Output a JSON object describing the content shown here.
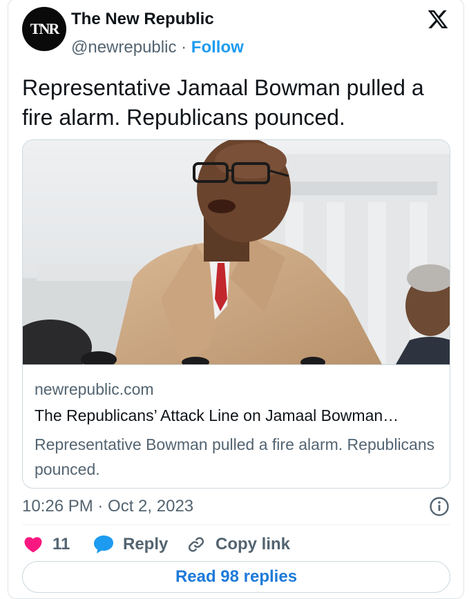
{
  "account": {
    "name": "The New Republic",
    "handle": "@newrepublic",
    "separator": "·",
    "follow_label": "Follow",
    "avatar_text": "TNR"
  },
  "tweet": {
    "text": "Representative Jamaal Bowman pulled a fire alarm. Republicans pounced."
  },
  "link_card": {
    "domain": "newrepublic.com",
    "title": "The Republicans’ Attack Line on Jamaal Bowman…",
    "description": "Representative Bowman pulled a fire alarm. Republicans pounced."
  },
  "meta": {
    "timestamp": "10:26 PM · Oct 2, 2023"
  },
  "actions": {
    "like_count": "11",
    "reply_label": "Reply",
    "copy_label": "Copy link"
  },
  "footer": {
    "read_replies_label": "Read 98 replies"
  },
  "colors": {
    "like": "#f91880",
    "reply": "#1d9bf0",
    "link": "#1d9bf0",
    "muted": "#536471"
  },
  "icons": [
    "x-logo-icon",
    "info-icon",
    "heart-icon",
    "reply-bubble-icon",
    "link-icon"
  ]
}
